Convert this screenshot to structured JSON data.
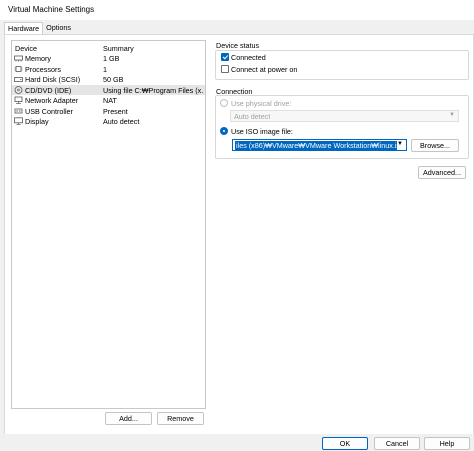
{
  "window": {
    "title": "Virtual Machine Settings"
  },
  "tabs": [
    {
      "label": "Hardware",
      "active": true
    },
    {
      "label": "Options",
      "active": false
    }
  ],
  "device_list": {
    "headers": {
      "device": "Device",
      "summary": "Summary"
    },
    "rows": [
      {
        "icon": "memory-icon",
        "device": "Memory",
        "summary": "1 GB",
        "selected": false
      },
      {
        "icon": "processor-icon",
        "device": "Processors",
        "summary": "1",
        "selected": false
      },
      {
        "icon": "hard-disk-icon",
        "device": "Hard Disk (SCSI)",
        "summary": "50 GB",
        "selected": false
      },
      {
        "icon": "cd-dvd-icon",
        "device": "CD/DVD (IDE)",
        "summary": "Using file C:₩Program Files (x...",
        "selected": true
      },
      {
        "icon": "network-adapter-icon",
        "device": "Network Adapter",
        "summary": "NAT",
        "selected": false
      },
      {
        "icon": "usb-icon",
        "device": "USB Controller",
        "summary": "Present",
        "selected": false
      },
      {
        "icon": "display-icon",
        "device": "Display",
        "summary": "Auto detect",
        "selected": false
      }
    ],
    "add_label": "Add...",
    "remove_label": "Remove"
  },
  "device_status": {
    "title": "Device status",
    "connected_label": "Connected",
    "connected": true,
    "power_on_label": "Connect at power on",
    "power_on": false
  },
  "connection": {
    "title": "Connection",
    "physical_label": "Use physical drive:",
    "physical_value": "Auto detect",
    "iso_label": "Use ISO image file:",
    "iso_value": "iles (x86)₩VMware₩VMware Workstation₩linux.iso",
    "browse_label": "Browse...",
    "selected_option": "iso"
  },
  "advanced_label": "Advanced...",
  "footer": {
    "ok_label": "OK",
    "cancel_label": "Cancel",
    "help_label": "Help"
  },
  "colors": {
    "accent": "#0067c0",
    "selection": "#e5e5e5"
  }
}
